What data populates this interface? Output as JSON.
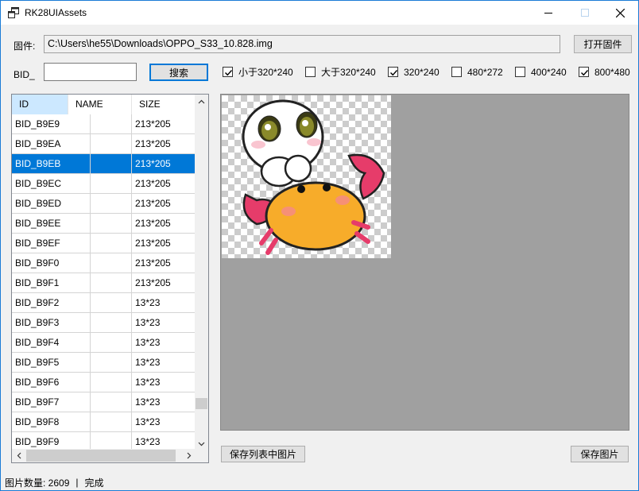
{
  "window": {
    "title": "RK28UIAssets"
  },
  "firmware": {
    "label": "固件:",
    "path": "C:\\Users\\he55\\Downloads\\OPPO_S33_10.828.img",
    "open_button": "打开固件"
  },
  "search": {
    "bid_label": "BID_",
    "value": "",
    "button": "搜索"
  },
  "filters": [
    {
      "label": "小于320*240",
      "checked": true
    },
    {
      "label": "大于320*240",
      "checked": false
    },
    {
      "label": "320*240",
      "checked": true
    },
    {
      "label": "480*272",
      "checked": false
    },
    {
      "label": "400*240",
      "checked": false
    },
    {
      "label": "800*480",
      "checked": true
    }
  ],
  "list": {
    "columns": [
      "ID",
      "NAME",
      "SIZE"
    ],
    "rows": [
      {
        "id": "BID_B9E9",
        "name": "",
        "size": "213*205",
        "selected": false
      },
      {
        "id": "BID_B9EA",
        "name": "",
        "size": "213*205",
        "selected": false
      },
      {
        "id": "BID_B9EB",
        "name": "",
        "size": "213*205",
        "selected": true
      },
      {
        "id": "BID_B9EC",
        "name": "",
        "size": "213*205",
        "selected": false
      },
      {
        "id": "BID_B9ED",
        "name": "",
        "size": "213*205",
        "selected": false
      },
      {
        "id": "BID_B9EE",
        "name": "",
        "size": "213*205",
        "selected": false
      },
      {
        "id": "BID_B9EF",
        "name": "",
        "size": "213*205",
        "selected": false
      },
      {
        "id": "BID_B9F0",
        "name": "",
        "size": "213*205",
        "selected": false
      },
      {
        "id": "BID_B9F1",
        "name": "",
        "size": "213*205",
        "selected": false
      },
      {
        "id": "BID_B9F2",
        "name": "",
        "size": "13*23",
        "selected": false
      },
      {
        "id": "BID_B9F3",
        "name": "",
        "size": "13*23",
        "selected": false
      },
      {
        "id": "BID_B9F4",
        "name": "",
        "size": "13*23",
        "selected": false
      },
      {
        "id": "BID_B9F5",
        "name": "",
        "size": "13*23",
        "selected": false
      },
      {
        "id": "BID_B9F6",
        "name": "",
        "size": "13*23",
        "selected": false
      },
      {
        "id": "BID_B9F7",
        "name": "",
        "size": "13*23",
        "selected": false
      },
      {
        "id": "BID_B9F8",
        "name": "",
        "size": "13*23",
        "selected": false
      },
      {
        "id": "BID_B9F9",
        "name": "",
        "size": "13*23",
        "selected": false
      }
    ]
  },
  "actions": {
    "save_list": "保存列表中图片",
    "save_image": "保存图片"
  },
  "status": {
    "count": "图片数量: 2609",
    "separator": "|",
    "state": "完成"
  }
}
